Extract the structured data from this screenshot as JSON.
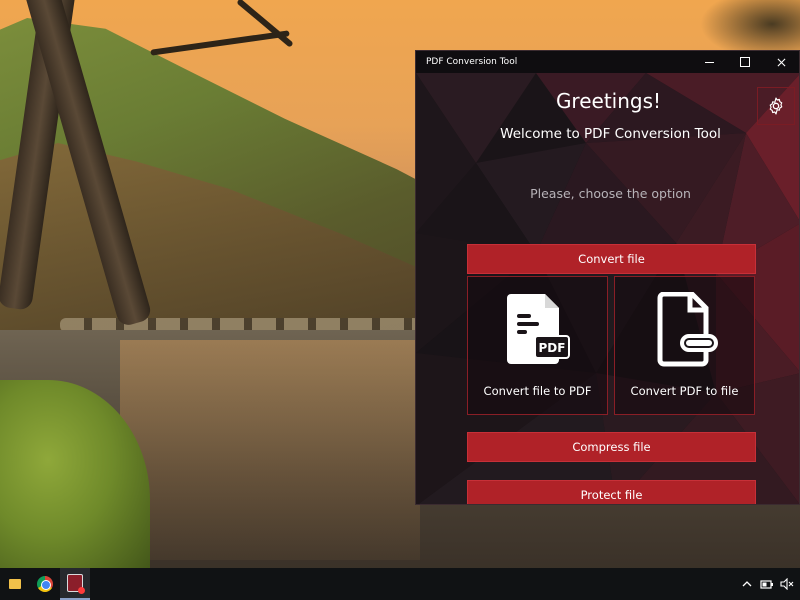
{
  "window": {
    "title": "PDF Conversion Tool",
    "controls": {
      "minimize": "minimize",
      "maximize": "maximize",
      "close": "close"
    }
  },
  "main": {
    "greeting": "Greetings!",
    "welcome": "Welcome to PDF Conversion Tool",
    "instruction": "Please, choose the option",
    "convert_header": "Convert file",
    "options": [
      {
        "label": "Convert file to PDF",
        "icon": "file-to-pdf-icon",
        "badge": "PDF"
      },
      {
        "label": "Convert PDF to file",
        "icon": "pdf-to-file-icon"
      }
    ],
    "compress_label": "Compress file",
    "protect_label": "Protect file"
  },
  "taskbar": {
    "items": [
      "file-explorer-icon",
      "chrome-icon",
      "pdf-conversion-tool-icon"
    ],
    "tray": [
      "chevron-up-icon",
      "battery-icon",
      "volume-muted-icon"
    ]
  },
  "colors": {
    "accent_red": "#b02228",
    "border_red": "#8a1e26",
    "window_bg": "#1a1418",
    "taskbar_bg": "#101214"
  }
}
